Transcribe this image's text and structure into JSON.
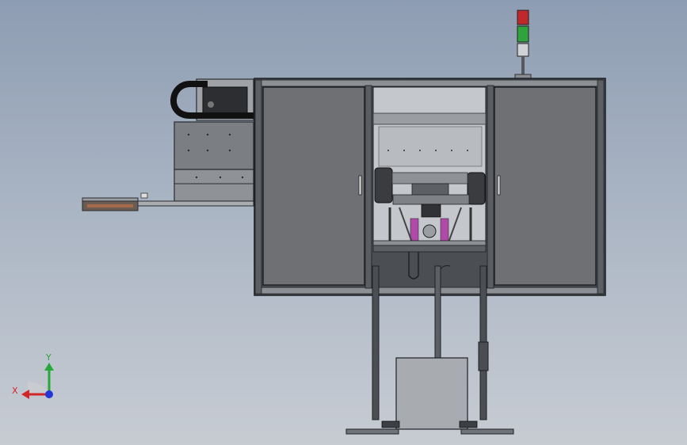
{
  "viewport": {
    "background_top": "#8e9db3",
    "background_bottom": "#c7ccd3"
  },
  "model": {
    "frame_color": "#3c3f44",
    "panel_color": "#6b6e72",
    "door_color": "#6e7074",
    "edge_color": "#1e2024",
    "signal_tower": {
      "lamps": [
        "#c0282a",
        "#2fa43c",
        "#cfd2d6"
      ]
    }
  },
  "triad": {
    "x_label": "X",
    "y_label": "Y",
    "x_color": "#d32626",
    "y_color": "#27a83a",
    "z_color": "#2336d8",
    "icon": "coordinate-triad-icon"
  }
}
